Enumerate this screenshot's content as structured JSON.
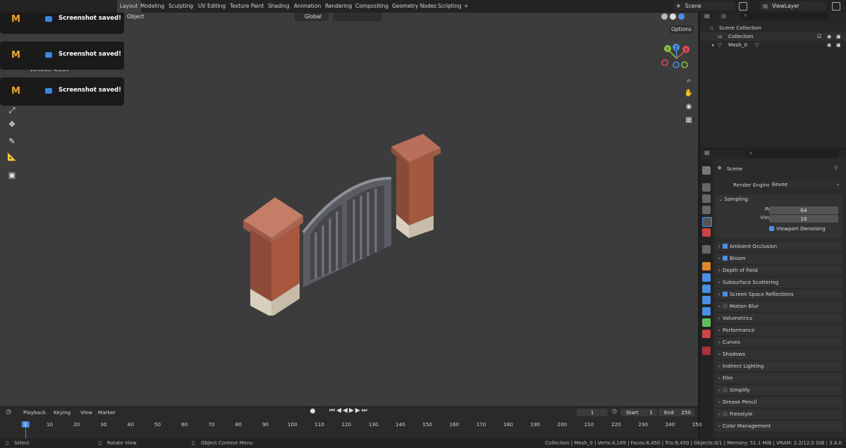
{
  "topbar": {
    "workspaces": [
      "Layout",
      "Modeling",
      "Sculpting",
      "UV Editing",
      "Texture Paint",
      "Shading",
      "Animation",
      "Rendering",
      "Compositing",
      "Geometry Nodes",
      "Scripting"
    ],
    "active_workspace": "Layout",
    "add_tab": "+",
    "scene": "Scene",
    "view_layer": "ViewLayer"
  },
  "toasts": [
    {
      "logo": "M",
      "message": "Screenshot saved!"
    },
    {
      "logo": "M",
      "message": "Screenshot saved!"
    },
    {
      "logo": "M",
      "message": "Screenshot saved!"
    }
  ],
  "viewport": {
    "header_object": "Object",
    "orientation": "Global",
    "options": "Options",
    "stats": {
      "vertices_label": "Vertices",
      "vertices_value": "4,189"
    },
    "gizmo": {
      "x": "X",
      "y": "Y",
      "z": "Z"
    }
  },
  "outliner": {
    "items": [
      {
        "label": "Scene Collection"
      },
      {
        "label": "Collection"
      },
      {
        "label": "Mesh_0"
      }
    ]
  },
  "properties": {
    "context": "Scene",
    "render_engine_label": "Render Engine",
    "render_engine": "Eevee",
    "sampling": {
      "title": "Sampling",
      "render_label": "Render",
      "render_value": "64",
      "viewport_label": "Viewport",
      "viewport_value": "16",
      "denoise_label": "Viewport Denoising"
    },
    "panels": [
      {
        "label": "Ambient Occlusion",
        "checkbox": "on"
      },
      {
        "label": "Bloom",
        "checkbox": "on"
      },
      {
        "label": "Depth of Field",
        "checkbox": "none"
      },
      {
        "label": "Subsurface Scattering",
        "checkbox": "none"
      },
      {
        "label": "Screen Space Reflections",
        "checkbox": "on"
      },
      {
        "label": "Motion Blur",
        "checkbox": "off"
      },
      {
        "label": "Volumetrics",
        "checkbox": "none"
      },
      {
        "label": "Performance",
        "checkbox": "none"
      },
      {
        "label": "Curves",
        "checkbox": "none"
      },
      {
        "label": "Shadows",
        "checkbox": "none"
      },
      {
        "label": "Indirect Lighting",
        "checkbox": "none"
      },
      {
        "label": "Film",
        "checkbox": "none"
      },
      {
        "label": "Simplify",
        "checkbox": "off"
      },
      {
        "label": "Grease Pencil",
        "checkbox": "none"
      },
      {
        "label": "Freestyle",
        "checkbox": "off"
      },
      {
        "label": "Color Management",
        "checkbox": "none"
      }
    ]
  },
  "timeline": {
    "menus": [
      "Playback",
      "Keying",
      "View",
      "Marker"
    ],
    "current_frame": "1",
    "start_label": "Start",
    "start": "1",
    "end_label": "End",
    "end": "250",
    "ticks": [
      "1",
      "10",
      "20",
      "30",
      "40",
      "50",
      "60",
      "70",
      "80",
      "90",
      "100",
      "110",
      "120",
      "130",
      "140",
      "150",
      "160",
      "170",
      "180",
      "190",
      "200",
      "210",
      "220",
      "230",
      "240",
      "250"
    ]
  },
  "statusbar": {
    "select": "Select",
    "rotate": "Rotate View",
    "context_menu": "Object Context Menu",
    "stats": "Collection | Mesh_0 | Verts:4,189 | Faces:8,450 | Tris:8,450 | Objects:0/1 | Memory: 51.1 MiB | VRAM: 2.2/12.0 GiB | 3.4.0"
  },
  "colors": {
    "accent": "#4a8ee6",
    "toast_logo": "#f3a32c",
    "viewport_bg": "#3c3c3c"
  }
}
